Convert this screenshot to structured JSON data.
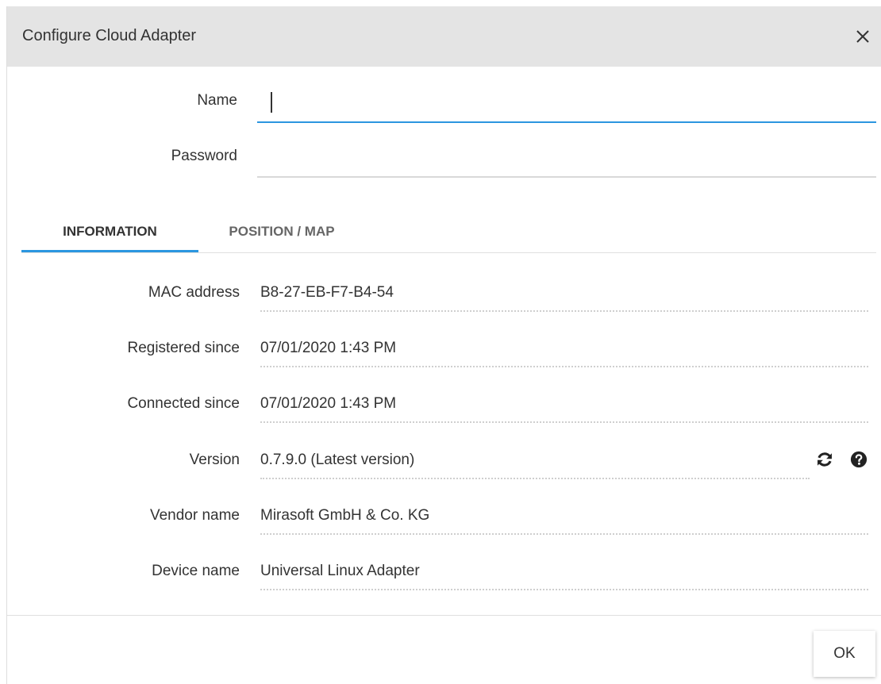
{
  "dialog": {
    "title": "Configure Cloud Adapter",
    "close_label": "close"
  },
  "form": {
    "name_label": "Name",
    "name_value": "",
    "password_label": "Password",
    "password_value": ""
  },
  "tabs": [
    {
      "label": "INFORMATION",
      "active": true
    },
    {
      "label": "POSITION / MAP",
      "active": false
    }
  ],
  "info": {
    "mac_label": "MAC address",
    "mac_value": "B8-27-EB-F7-B4-54",
    "registered_label": "Registered since",
    "registered_value": "07/01/2020 1:43 PM",
    "connected_label": "Connected since",
    "connected_value": "07/01/2020 1:43 PM",
    "version_label": "Version",
    "version_value": "0.7.9.0 (Latest version)",
    "vendor_label": "Vendor name",
    "vendor_value": "Mirasoft GmbH & Co. KG",
    "device_label": "Device name",
    "device_value": "Universal Linux Adapter"
  },
  "icons": {
    "refresh": "refresh-icon",
    "help": "help-icon",
    "close": "close-icon"
  },
  "footer": {
    "ok_label": "OK"
  },
  "colors": {
    "accent": "#2b96e0",
    "header_bg": "#e4e4e4"
  }
}
